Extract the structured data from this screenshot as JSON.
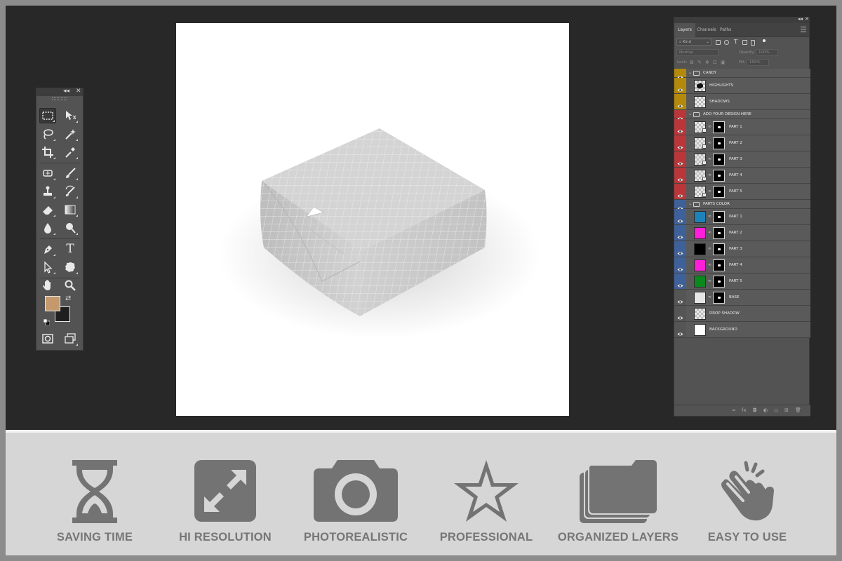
{
  "toolbar": {
    "header_buttons": [
      "◂◂",
      "✕"
    ],
    "tools": [
      [
        "rectangular-marquee-icon",
        "move-icon"
      ],
      [
        "lasso-icon",
        "magic-wand-icon"
      ],
      [
        "crop-icon",
        "eyedropper-icon"
      ],
      [
        "spot-healing-icon",
        "brush-icon"
      ],
      [
        "clone-stamp-icon",
        "history-brush-icon"
      ],
      [
        "eraser-icon",
        "gradient-icon"
      ],
      [
        "blur-icon",
        "dodge-icon"
      ],
      [
        "pen-icon",
        "type-icon"
      ],
      [
        "path-selection-icon",
        "custom-shape-icon"
      ],
      [
        "hand-icon",
        "zoom-icon"
      ]
    ],
    "type_tool_glyph": "T",
    "foreground_color": "#c49a6c",
    "background_color": "#1f1f1f"
  },
  "layers_panel": {
    "header_buttons": [
      "◂◂",
      "✕"
    ],
    "tabs": [
      "Layers",
      "Channels",
      "Paths"
    ],
    "active_tab": "Layers",
    "filter_kind": "Kind",
    "blend_mode": "Normal",
    "opacity_label": "Opacity:",
    "opacity_value": "100%",
    "lock_label": "Lock:",
    "fill_label": "Fill:",
    "fill_value": "100%",
    "layers": [
      {
        "type": "group",
        "name": "CANDY",
        "color": "#b38a0b"
      },
      {
        "type": "layer",
        "name": "HIGHLIGHTS",
        "color": "#b38a0b",
        "thumb": "highlight"
      },
      {
        "type": "layer",
        "name": "SHADOWS",
        "color": "#b38a0b",
        "thumb": "checker"
      },
      {
        "type": "group",
        "name": "ADD YOUR DESIGN HERE",
        "color": "#b9373a"
      },
      {
        "type": "smart",
        "name": "PART 1",
        "color": "#b9373a"
      },
      {
        "type": "smart",
        "name": "PART 2",
        "color": "#b9373a"
      },
      {
        "type": "smart",
        "name": "PART 3",
        "color": "#b9373a"
      },
      {
        "type": "smart",
        "name": "PART 4",
        "color": "#b9373a"
      },
      {
        "type": "smart",
        "name": "PART 5",
        "color": "#b9373a"
      },
      {
        "type": "group",
        "name": "PARTS COLOR",
        "color": "#3f6199"
      },
      {
        "type": "fill",
        "name": "PART 1",
        "color": "#3f6199",
        "swatch": "#1e82b8"
      },
      {
        "type": "fill",
        "name": "PART 2",
        "color": "#3f6199",
        "swatch": "#ff1ed9"
      },
      {
        "type": "fill",
        "name": "PART 3",
        "color": "#3f6199",
        "swatch": "#000000"
      },
      {
        "type": "fill",
        "name": "PART 4",
        "color": "#3f6199",
        "swatch": "#ff1ed9"
      },
      {
        "type": "fill",
        "name": "PART 5",
        "color": "#3f6199",
        "swatch": "#0a8a1e"
      },
      {
        "type": "fill",
        "name": "BASE",
        "color": null,
        "swatch": "#e6e6e6"
      },
      {
        "type": "layer",
        "name": "DROP SHADOW",
        "color": null,
        "thumb": "checker"
      },
      {
        "type": "layer",
        "name": "BACKGROUND",
        "color": null,
        "thumb": "white"
      }
    ],
    "footer_icons": [
      "∞",
      "fx",
      "◘",
      "◐",
      "▭",
      "⊞",
      "🗑"
    ]
  },
  "features": [
    {
      "label": "SAVING TIME",
      "icon": "hourglass-icon"
    },
    {
      "label": "HI RESOLUTION",
      "icon": "expand-arrows-icon"
    },
    {
      "label": "PHOTOREALISTIC",
      "icon": "camera-icon"
    },
    {
      "label": "PROFESSIONAL",
      "icon": "star-icon"
    },
    {
      "label": "ORGANIZED LAYERS",
      "icon": "stacked-folders-icon"
    },
    {
      "label": "EASY TO USE",
      "icon": "hand-tap-icon"
    }
  ],
  "colors": {
    "workspace": "#282828",
    "panel": "#535353",
    "feature_icon": "#737373",
    "feature_text": "#767676"
  }
}
